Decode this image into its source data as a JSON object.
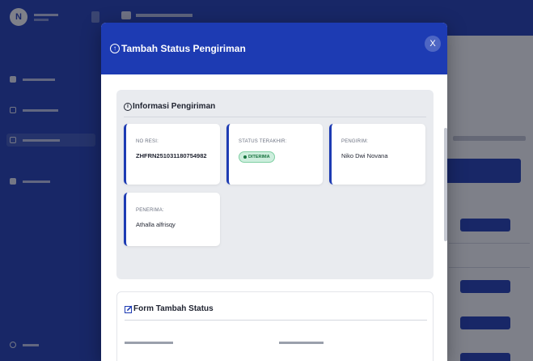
{
  "background": {
    "user_initial": "N",
    "modal_partial": true
  },
  "modal": {
    "title": "Tambah Status Pengiriman",
    "close_glyph": "X",
    "title_icon": "arrow-up-circle-icon",
    "info_section": {
      "title": "Informasi Pengiriman",
      "icon": "info-circle-icon",
      "fields": {
        "resi": {
          "label": "NO RESI:",
          "value": "ZHFRN251031180754982"
        },
        "status": {
          "label": "STATUS TERAKHIR:",
          "value": "DITERIMA"
        },
        "pengirim": {
          "label": "PENGIRIM:",
          "value": "Niko Dwi Novana"
        },
        "penerima": {
          "label": "PENERIMA:",
          "value": "Athalla alfrisqy"
        }
      }
    },
    "form_section": {
      "title": "Form Tambah Status",
      "icon": "edit-icon"
    }
  },
  "colors": {
    "primary": "#1d3bb3",
    "badge_bg": "#cdeedd",
    "badge_text": "#17733f"
  }
}
